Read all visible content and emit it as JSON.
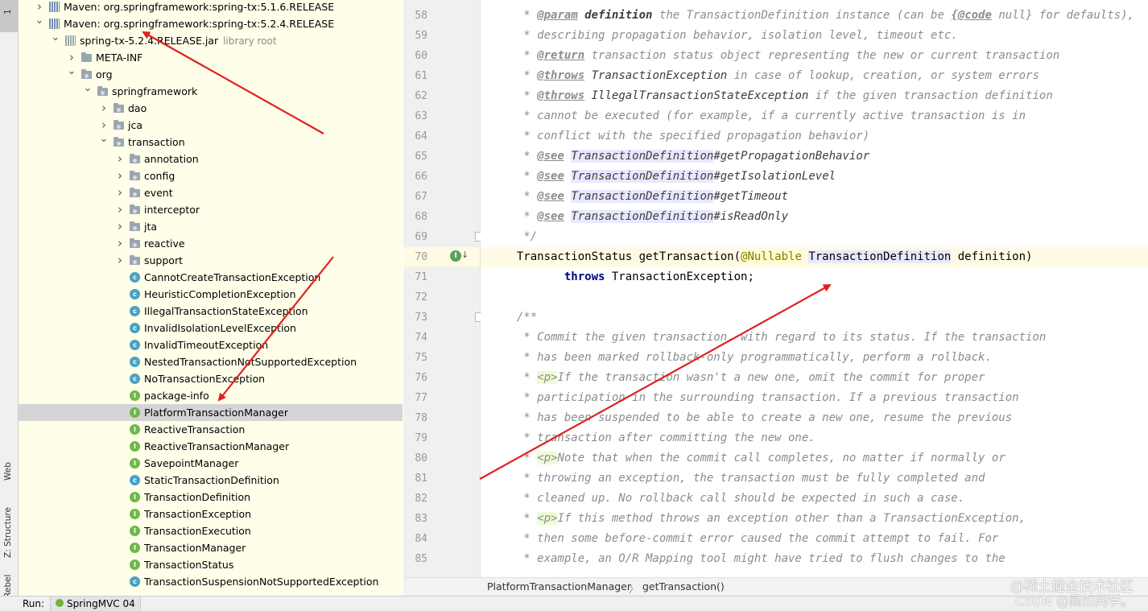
{
  "tool_windows": {
    "left": [
      {
        "label": "1",
        "name": "project"
      },
      {
        "label": "Web",
        "name": "web"
      },
      {
        "label": "Z: Structure",
        "name": "structure"
      },
      {
        "label": "JRebel",
        "name": "jrebel"
      }
    ]
  },
  "project_tree": {
    "rows": [
      {
        "depth": 0,
        "arrow": "right",
        "icon": "maven",
        "label": "Maven: org.springframework:spring-tx:5.1.6.RELEASE"
      },
      {
        "depth": 0,
        "arrow": "down",
        "icon": "maven",
        "label": "Maven: org.springframework:spring-tx:5.2.4.RELEASE"
      },
      {
        "depth": 1,
        "arrow": "down",
        "icon": "library",
        "label": "spring-tx-5.2.4.RELEASE.jar",
        "hint": "library root"
      },
      {
        "depth": 2,
        "arrow": "right",
        "icon": "folder",
        "label": "META-INF"
      },
      {
        "depth": 2,
        "arrow": "down",
        "icon": "package",
        "label": "org"
      },
      {
        "depth": 3,
        "arrow": "down",
        "icon": "package",
        "label": "springframework"
      },
      {
        "depth": 4,
        "arrow": "right",
        "icon": "package",
        "label": "dao"
      },
      {
        "depth": 4,
        "arrow": "right",
        "icon": "package",
        "label": "jca"
      },
      {
        "depth": 4,
        "arrow": "down",
        "icon": "package",
        "label": "transaction"
      },
      {
        "depth": 5,
        "arrow": "right",
        "icon": "package",
        "label": "annotation"
      },
      {
        "depth": 5,
        "arrow": "right",
        "icon": "package",
        "label": "config"
      },
      {
        "depth": 5,
        "arrow": "right",
        "icon": "package",
        "label": "event"
      },
      {
        "depth": 5,
        "arrow": "right",
        "icon": "package",
        "label": "interceptor"
      },
      {
        "depth": 5,
        "arrow": "right",
        "icon": "package",
        "label": "jta"
      },
      {
        "depth": 5,
        "arrow": "right",
        "icon": "package",
        "label": "reactive"
      },
      {
        "depth": 5,
        "arrow": "right",
        "icon": "package",
        "label": "support"
      },
      {
        "depth": 5,
        "arrow": "",
        "icon": "class",
        "label": "CannotCreateTransactionException"
      },
      {
        "depth": 5,
        "arrow": "",
        "icon": "class",
        "label": "HeuristicCompletionException"
      },
      {
        "depth": 5,
        "arrow": "",
        "icon": "class",
        "label": "IllegalTransactionStateException"
      },
      {
        "depth": 5,
        "arrow": "",
        "icon": "class",
        "label": "InvalidIsolationLevelException"
      },
      {
        "depth": 5,
        "arrow": "",
        "icon": "class",
        "label": "InvalidTimeoutException"
      },
      {
        "depth": 5,
        "arrow": "",
        "icon": "class",
        "label": "NestedTransactionNotSupportedException"
      },
      {
        "depth": 5,
        "arrow": "",
        "icon": "class",
        "label": "NoTransactionException"
      },
      {
        "depth": 5,
        "arrow": "",
        "icon": "interface",
        "label": "package-info"
      },
      {
        "depth": 5,
        "arrow": "",
        "icon": "interface",
        "label": "PlatformTransactionManager",
        "selected": true
      },
      {
        "depth": 5,
        "arrow": "",
        "icon": "interface",
        "label": "ReactiveTransaction"
      },
      {
        "depth": 5,
        "arrow": "",
        "icon": "interface",
        "label": "ReactiveTransactionManager"
      },
      {
        "depth": 5,
        "arrow": "",
        "icon": "interface",
        "label": "SavepointManager"
      },
      {
        "depth": 5,
        "arrow": "",
        "icon": "class",
        "label": "StaticTransactionDefinition"
      },
      {
        "depth": 5,
        "arrow": "",
        "icon": "interface",
        "label": "TransactionDefinition"
      },
      {
        "depth": 5,
        "arrow": "",
        "icon": "interface",
        "label": "TransactionException"
      },
      {
        "depth": 5,
        "arrow": "",
        "icon": "interface",
        "label": "TransactionExecution"
      },
      {
        "depth": 5,
        "arrow": "",
        "icon": "interface",
        "label": "TransactionManager"
      },
      {
        "depth": 5,
        "arrow": "",
        "icon": "interface",
        "label": "TransactionStatus"
      },
      {
        "depth": 5,
        "arrow": "",
        "icon": "class",
        "label": "TransactionSuspensionNotSupportedException"
      }
    ]
  },
  "editor": {
    "lines": [
      {
        "n": "58",
        "parts": [
          [
            "cm",
            "   * "
          ],
          [
            "tag",
            "@param"
          ],
          [
            "cm",
            " "
          ],
          [
            "tname",
            "definition"
          ],
          [
            "cm",
            " the TransactionDefinition instance (can be "
          ],
          [
            "tag",
            "{@code"
          ],
          [
            "cm",
            " null} for defaults),"
          ]
        ]
      },
      {
        "n": "59",
        "parts": [
          [
            "cm",
            "   * describing propagation behavior, isolation level, timeout etc."
          ]
        ]
      },
      {
        "n": "60",
        "parts": [
          [
            "cm",
            "   * "
          ],
          [
            "tag",
            "@return"
          ],
          [
            "cm",
            " transaction status object representing the new or current transaction"
          ]
        ]
      },
      {
        "n": "61",
        "parts": [
          [
            "cm",
            "   * "
          ],
          [
            "tag",
            "@throws"
          ],
          [
            "cm",
            " "
          ],
          [
            "ref",
            "TransactionException"
          ],
          [
            "cm",
            " in case of lookup, creation, or system errors"
          ]
        ]
      },
      {
        "n": "62",
        "parts": [
          [
            "cm",
            "   * "
          ],
          [
            "tag",
            "@throws"
          ],
          [
            "cm",
            " "
          ],
          [
            "ref",
            "IllegalTransactionStateException"
          ],
          [
            "cm",
            " if the given transaction definition"
          ]
        ]
      },
      {
        "n": "63",
        "parts": [
          [
            "cm",
            "   * cannot be executed (for example, if a currently active transaction is in"
          ]
        ]
      },
      {
        "n": "64",
        "parts": [
          [
            "cm",
            "   * conflict with the specified propagation behavior)"
          ]
        ]
      },
      {
        "n": "65",
        "parts": [
          [
            "cm",
            "   * "
          ],
          [
            "tag",
            "@see"
          ],
          [
            "cm",
            " "
          ],
          [
            "lnk",
            "TransactionDefinition"
          ],
          [
            "ref",
            "#getPropagationBehavior"
          ]
        ]
      },
      {
        "n": "66",
        "parts": [
          [
            "cm",
            "   * "
          ],
          [
            "tag",
            "@see"
          ],
          [
            "cm",
            " "
          ],
          [
            "lnk",
            "TransactionDefinition"
          ],
          [
            "ref",
            "#getIsolationLevel"
          ]
        ]
      },
      {
        "n": "67",
        "parts": [
          [
            "cm",
            "   * "
          ],
          [
            "tag",
            "@see"
          ],
          [
            "cm",
            " "
          ],
          [
            "lnk",
            "TransactionDefinition"
          ],
          [
            "ref",
            "#getTimeout"
          ]
        ]
      },
      {
        "n": "68",
        "parts": [
          [
            "cm",
            "   * "
          ],
          [
            "tag",
            "@see"
          ],
          [
            "cm",
            " "
          ],
          [
            "lnk",
            "TransactionDefinition"
          ],
          [
            "ref",
            "#isReadOnly"
          ]
        ]
      },
      {
        "n": "69",
        "parts": [
          [
            "cm",
            "   */"
          ]
        ]
      },
      {
        "n": "70",
        "current": true,
        "parts": [
          [
            "",
            "  TransactionStatus getTransaction("
          ],
          [
            "ann",
            "@Nullable"
          ],
          [
            "",
            " "
          ],
          [
            "hl",
            "TransactionDefinition"
          ],
          [
            "",
            " definition)"
          ]
        ]
      },
      {
        "n": "71",
        "parts": [
          [
            "",
            "         "
          ],
          [
            "kw",
            "throws"
          ],
          [
            "",
            " TransactionException;"
          ]
        ]
      },
      {
        "n": "72",
        "parts": [
          [
            "",
            ""
          ]
        ]
      },
      {
        "n": "73",
        "parts": [
          [
            "cm",
            "  /**"
          ]
        ]
      },
      {
        "n": "74",
        "parts": [
          [
            "cm",
            "   * Commit the given transaction, with regard to its status. If the transaction"
          ]
        ]
      },
      {
        "n": "75",
        "parts": [
          [
            "cm",
            "   * has been marked rollback-only programmatically, perform a rollback."
          ]
        ]
      },
      {
        "n": "76",
        "parts": [
          [
            "cm",
            "   * "
          ],
          [
            "ptag",
            "<p>"
          ],
          [
            "cm",
            "If the transaction wasn't a new one, omit the commit for proper"
          ]
        ]
      },
      {
        "n": "77",
        "parts": [
          [
            "cm",
            "   * participation in the surrounding transaction. If a previous transaction"
          ]
        ]
      },
      {
        "n": "78",
        "parts": [
          [
            "cm",
            "   * has been suspended to be able to create a new one, resume the previous"
          ]
        ]
      },
      {
        "n": "79",
        "parts": [
          [
            "cm",
            "   * transaction after committing the new one."
          ]
        ]
      },
      {
        "n": "80",
        "parts": [
          [
            "cm",
            "   * "
          ],
          [
            "ptag",
            "<p>"
          ],
          [
            "cm",
            "Note that when the commit call completes, no matter if normally or"
          ]
        ]
      },
      {
        "n": "81",
        "parts": [
          [
            "cm",
            "   * throwing an exception, the transaction must be fully completed and"
          ]
        ]
      },
      {
        "n": "82",
        "parts": [
          [
            "cm",
            "   * cleaned up. No rollback call should be expected in such a case."
          ]
        ]
      },
      {
        "n": "83",
        "parts": [
          [
            "cm",
            "   * "
          ],
          [
            "ptag",
            "<p>"
          ],
          [
            "cm",
            "If this method throws an exception other than a TransactionException,"
          ]
        ]
      },
      {
        "n": "84",
        "parts": [
          [
            "cm",
            "   * then some before-commit error caused the commit attempt to fail. For"
          ]
        ]
      },
      {
        "n": "85",
        "parts": [
          [
            "cm",
            "   * example, an O/R Mapping tool might have tried to flush changes to the"
          ]
        ]
      }
    ]
  },
  "breadcrumb": {
    "class": "PlatformTransactionManager",
    "separator": "〉",
    "method": "getTransaction()"
  },
  "bottom_bar": {
    "run_label": "Run:",
    "run_config": "SpringMVC 04"
  },
  "watermark": {
    "line1": "@稀土掘金技术社区",
    "line2": "CSDN @阚然同学。"
  },
  "colors": {
    "tree_background": "#fefee9",
    "selection": "#d5d5d5",
    "annotation_arrow": "#e02020",
    "comment": "#8c8c8c",
    "keyword": "#000080"
  }
}
